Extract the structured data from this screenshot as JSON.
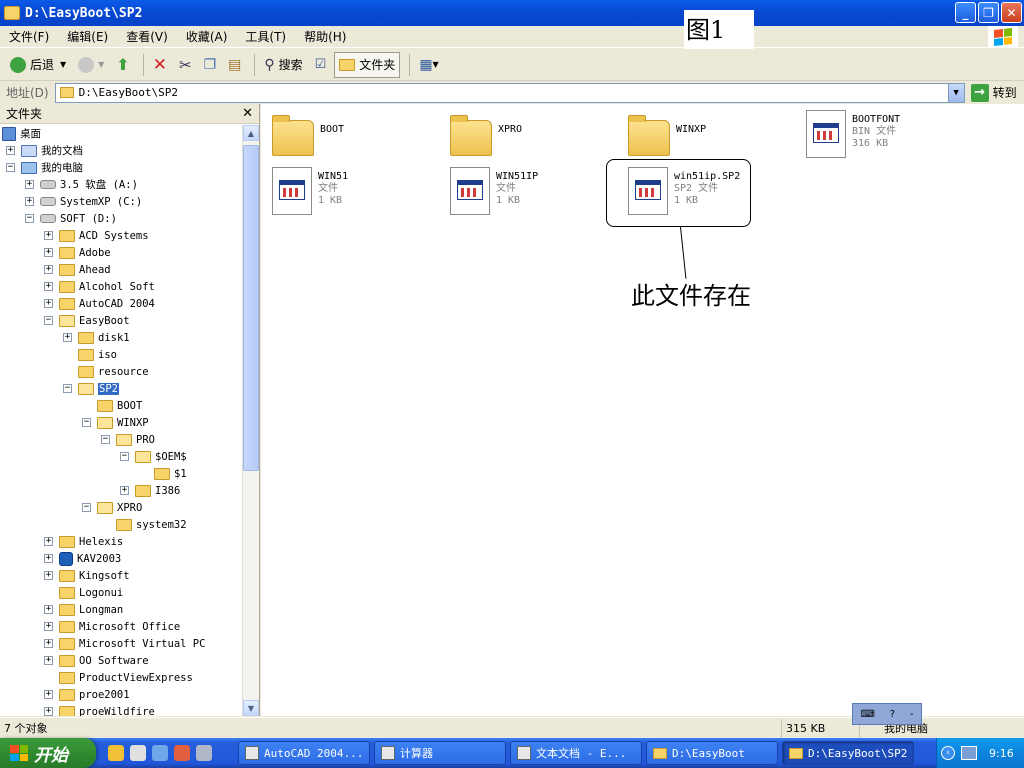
{
  "window": {
    "title": "D:\\EasyBoot\\SP2"
  },
  "menu": [
    "文件(F)",
    "编辑(E)",
    "查看(V)",
    "收藏(A)",
    "工具(T)",
    "帮助(H)"
  ],
  "figure_label": "图1",
  "toolbar": {
    "back": "后退",
    "search": "搜索",
    "folders": "文件夹"
  },
  "address": {
    "label": "地址(D)",
    "value": "D:\\EasyBoot\\SP2",
    "go": "转到"
  },
  "folder_pane": {
    "title": "文件夹",
    "nodes": [
      "桌面",
      "我的文档",
      "我的电脑",
      "3.5 软盘 (A:)",
      "SystemXP (C:)",
      "SOFT (D:)",
      "ACD Systems",
      "Adobe",
      "Ahead",
      "Alcohol Soft",
      "AutoCAD 2004",
      "EasyBoot",
      "disk1",
      "iso",
      "resource",
      "SP2",
      "BOOT",
      "WINXP",
      "PRO",
      "$OEM$",
      "$1",
      "I386",
      "XPRO",
      "system32",
      "Helexis",
      "KAV2003",
      "Kingsoft",
      "Logonui",
      "Longman",
      "Microsoft Office",
      "Microsoft Virtual PC",
      "OO Software",
      "ProductViewExpress",
      "proe2001",
      "proeWildfire"
    ]
  },
  "items": [
    {
      "name": "BOOT",
      "type": "",
      "size": ""
    },
    {
      "name": "XPRO",
      "type": "",
      "size": ""
    },
    {
      "name": "WINXP",
      "type": "",
      "size": ""
    },
    {
      "name": "BOOTFONT",
      "type": "BIN 文件",
      "size": "316 KB"
    },
    {
      "name": "WIN51",
      "type": "文件",
      "size": "1 KB"
    },
    {
      "name": "WIN51IP",
      "type": "文件",
      "size": "1 KB"
    },
    {
      "name": "win51ip.SP2",
      "type": "SP2 文件",
      "size": "1 KB"
    }
  ],
  "annotation": "此文件存在",
  "status": {
    "count": "7 个对象",
    "size": "315 KB",
    "location": "我的电脑"
  },
  "taskbar": {
    "start": "开始",
    "tasks": [
      "AutoCAD 2004...",
      "计算器",
      "文本文档 - E...",
      "D:\\EasyBoot",
      "D:\\EasyBoot\\SP2"
    ],
    "clock": "9:16"
  },
  "colors": {
    "title_bar": "#0A5BE8",
    "taskbar": "#245EDC",
    "start": "#2F8C2F",
    "selection": "#316AC5"
  }
}
